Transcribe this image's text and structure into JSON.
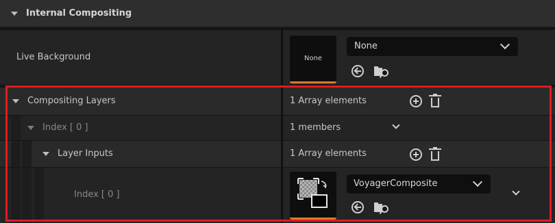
{
  "header": {
    "title": "Internal Compositing"
  },
  "live_background": {
    "label": "Live Background",
    "thumbnail_text": "None",
    "selected": "None"
  },
  "compositing_layers": {
    "label": "Compositing Layers",
    "value": "1 Array elements"
  },
  "index0": {
    "label": "Index [ 0 ]",
    "value": "1 members"
  },
  "layer_inputs": {
    "label": "Layer Inputs",
    "value": "1 Array elements"
  },
  "input_index0": {
    "label": "Index [ 0 ]",
    "selected": "VoyagerComposite"
  },
  "colors": {
    "highlight": "#e01b24",
    "header_bg": "#2f2f2f",
    "row_bg": "#242424"
  },
  "icons": [
    "plus-circle-icon",
    "trash-icon",
    "use-selected-arrow-icon",
    "browse-folder-icon",
    "chevron-down-icon",
    "expand-triangle-icon"
  ]
}
